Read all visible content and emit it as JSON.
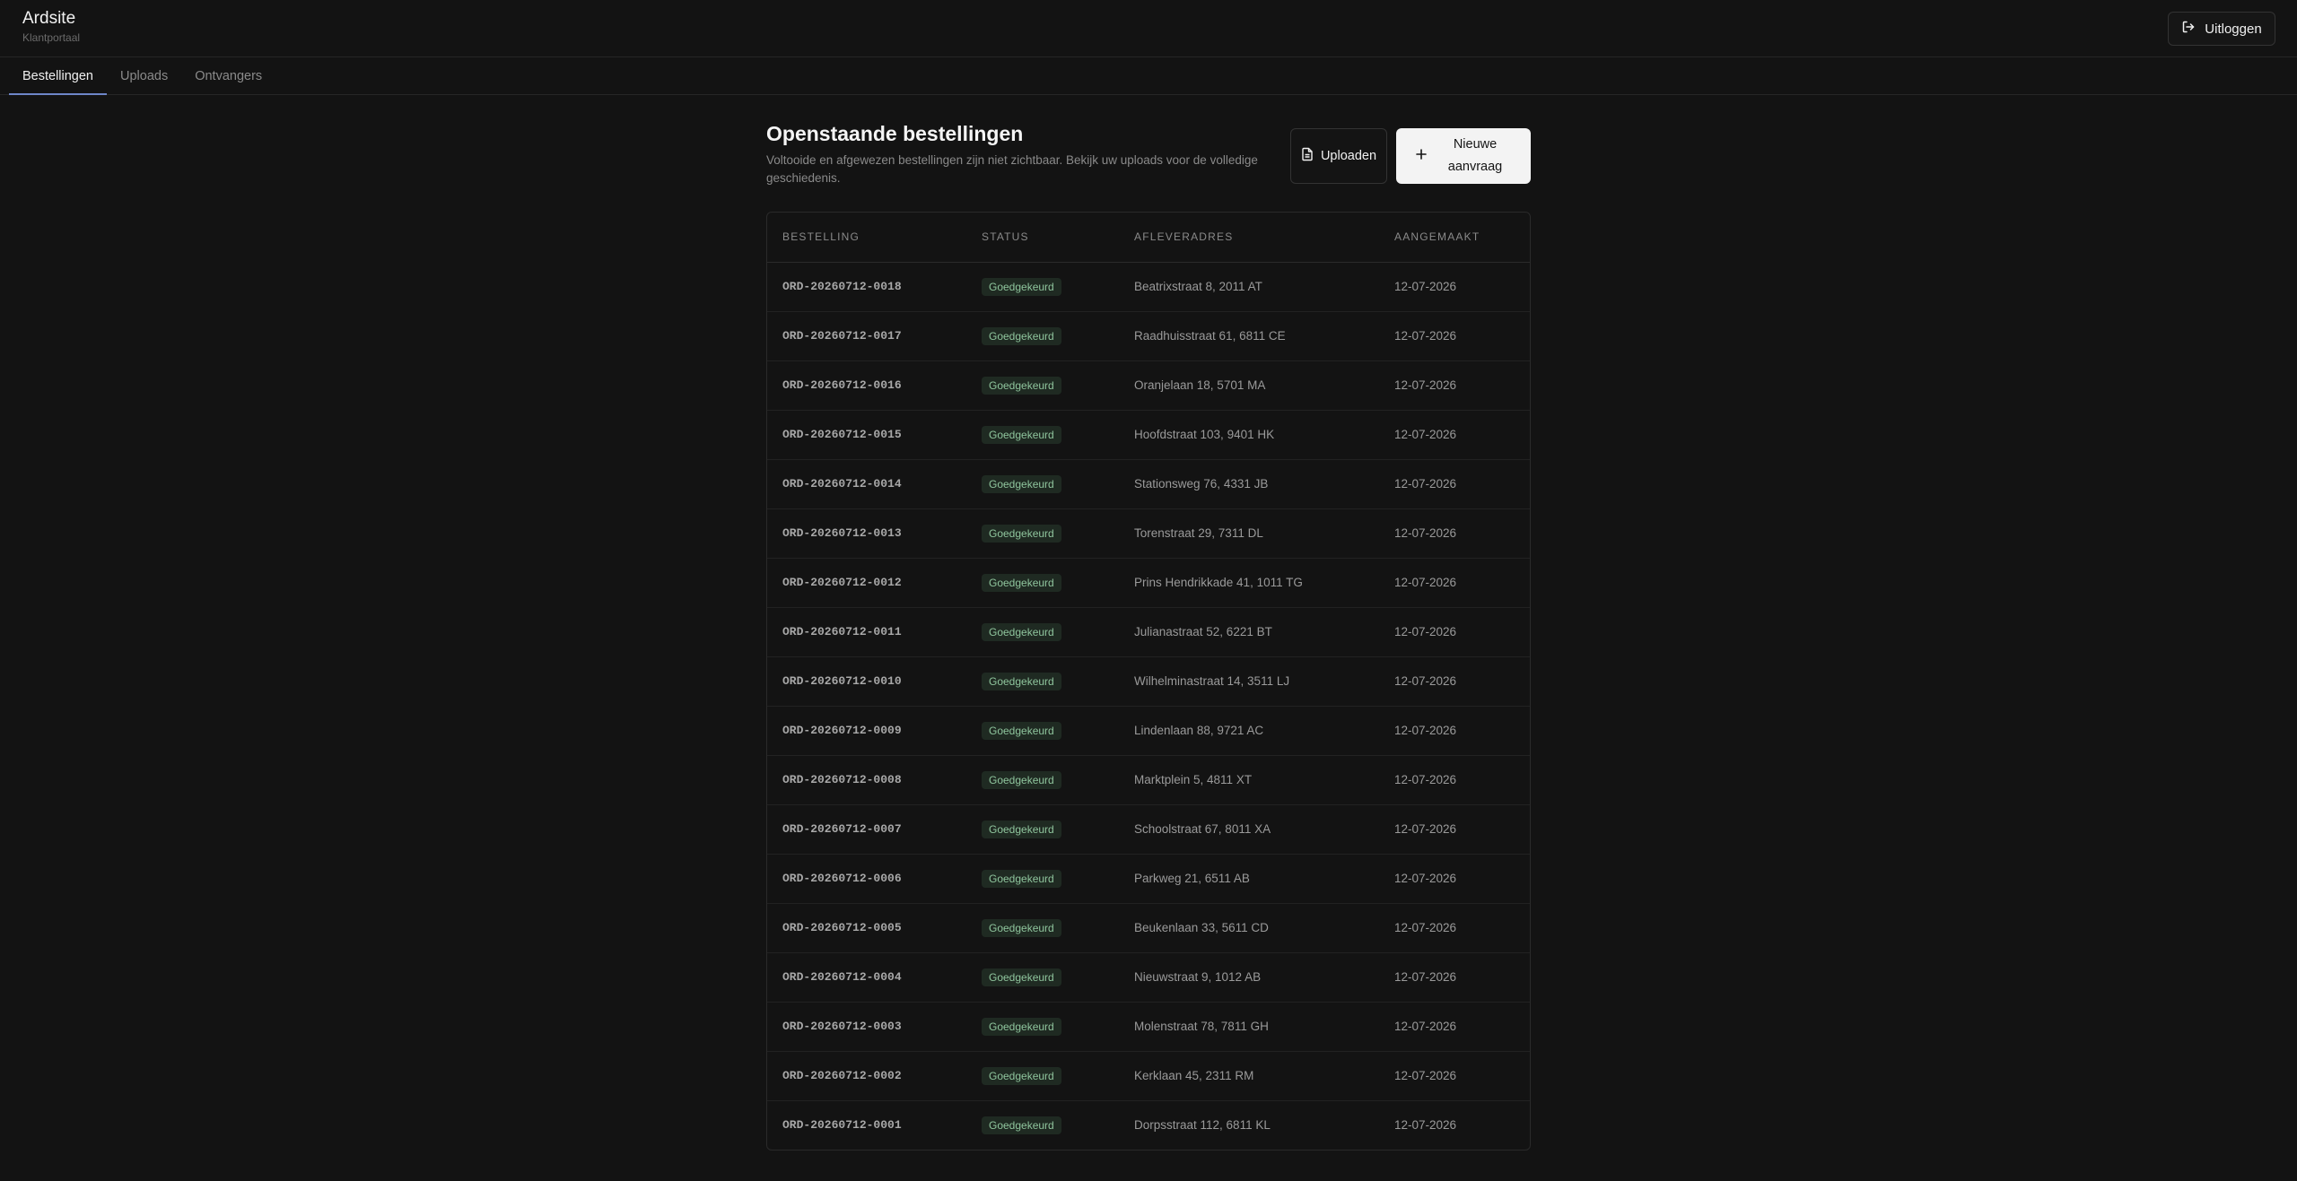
{
  "app": {
    "title": "Ardsite",
    "subtitle": "Klantportaal",
    "logout_label": "Uitloggen"
  },
  "tabs": [
    {
      "label": "Bestellingen",
      "active": true
    },
    {
      "label": "Uploads",
      "active": false
    },
    {
      "label": "Ontvangers",
      "active": false
    }
  ],
  "page": {
    "title": "Openstaande bestellingen",
    "subtitle": "Voltooide en afgewezen bestellingen zijn niet zichtbaar. Bekijk uw uploads voor de volledige geschiedenis.",
    "upload_label": "Uploaden",
    "new_request_label": "Nieuwe aanvraag"
  },
  "table": {
    "headers": [
      "BESTELLING",
      "STATUS",
      "AFLEVERADRES",
      "AANGEMAAKT"
    ],
    "rows": [
      {
        "order": "ORD-20260712-0018",
        "status": "Goedgekeurd",
        "address": "Beatrixstraat 8, 2011 AT",
        "created": "12-07-2026"
      },
      {
        "order": "ORD-20260712-0017",
        "status": "Goedgekeurd",
        "address": "Raadhuisstraat 61, 6811 CE",
        "created": "12-07-2026"
      },
      {
        "order": "ORD-20260712-0016",
        "status": "Goedgekeurd",
        "address": "Oranjelaan 18, 5701 MA",
        "created": "12-07-2026"
      },
      {
        "order": "ORD-20260712-0015",
        "status": "Goedgekeurd",
        "address": "Hoofdstraat 103, 9401 HK",
        "created": "12-07-2026"
      },
      {
        "order": "ORD-20260712-0014",
        "status": "Goedgekeurd",
        "address": "Stationsweg 76, 4331 JB",
        "created": "12-07-2026"
      },
      {
        "order": "ORD-20260712-0013",
        "status": "Goedgekeurd",
        "address": "Torenstraat 29, 7311 DL",
        "created": "12-07-2026"
      },
      {
        "order": "ORD-20260712-0012",
        "status": "Goedgekeurd",
        "address": "Prins Hendrikkade 41, 1011 TG",
        "created": "12-07-2026"
      },
      {
        "order": "ORD-20260712-0011",
        "status": "Goedgekeurd",
        "address": "Julianastraat 52, 6221 BT",
        "created": "12-07-2026"
      },
      {
        "order": "ORD-20260712-0010",
        "status": "Goedgekeurd",
        "address": "Wilhelminastraat 14, 3511 LJ",
        "created": "12-07-2026"
      },
      {
        "order": "ORD-20260712-0009",
        "status": "Goedgekeurd",
        "address": "Lindenlaan 88, 9721 AC",
        "created": "12-07-2026"
      },
      {
        "order": "ORD-20260712-0008",
        "status": "Goedgekeurd",
        "address": "Marktplein 5, 4811 XT",
        "created": "12-07-2026"
      },
      {
        "order": "ORD-20260712-0007",
        "status": "Goedgekeurd",
        "address": "Schoolstraat 67, 8011 XA",
        "created": "12-07-2026"
      },
      {
        "order": "ORD-20260712-0006",
        "status": "Goedgekeurd",
        "address": "Parkweg 21, 6511 AB",
        "created": "12-07-2026"
      },
      {
        "order": "ORD-20260712-0005",
        "status": "Goedgekeurd",
        "address": "Beukenlaan 33, 5611 CD",
        "created": "12-07-2026"
      },
      {
        "order": "ORD-20260712-0004",
        "status": "Goedgekeurd",
        "address": "Nieuwstraat 9, 1012 AB",
        "created": "12-07-2026"
      },
      {
        "order": "ORD-20260712-0003",
        "status": "Goedgekeurd",
        "address": "Molenstraat 78, 7811 GH",
        "created": "12-07-2026"
      },
      {
        "order": "ORD-20260712-0002",
        "status": "Goedgekeurd",
        "address": "Kerklaan 45, 2311 RM",
        "created": "12-07-2026"
      },
      {
        "order": "ORD-20260712-0001",
        "status": "Goedgekeurd",
        "address": "Dorpsstraat 112, 6811 KL",
        "created": "12-07-2026"
      }
    ]
  },
  "icons": {
    "logout": "logout-icon",
    "upload": "file-icon",
    "new": "plus-icon"
  },
  "colors": {
    "accent": "#6e86c9",
    "status_approved": "#8fc59d"
  }
}
